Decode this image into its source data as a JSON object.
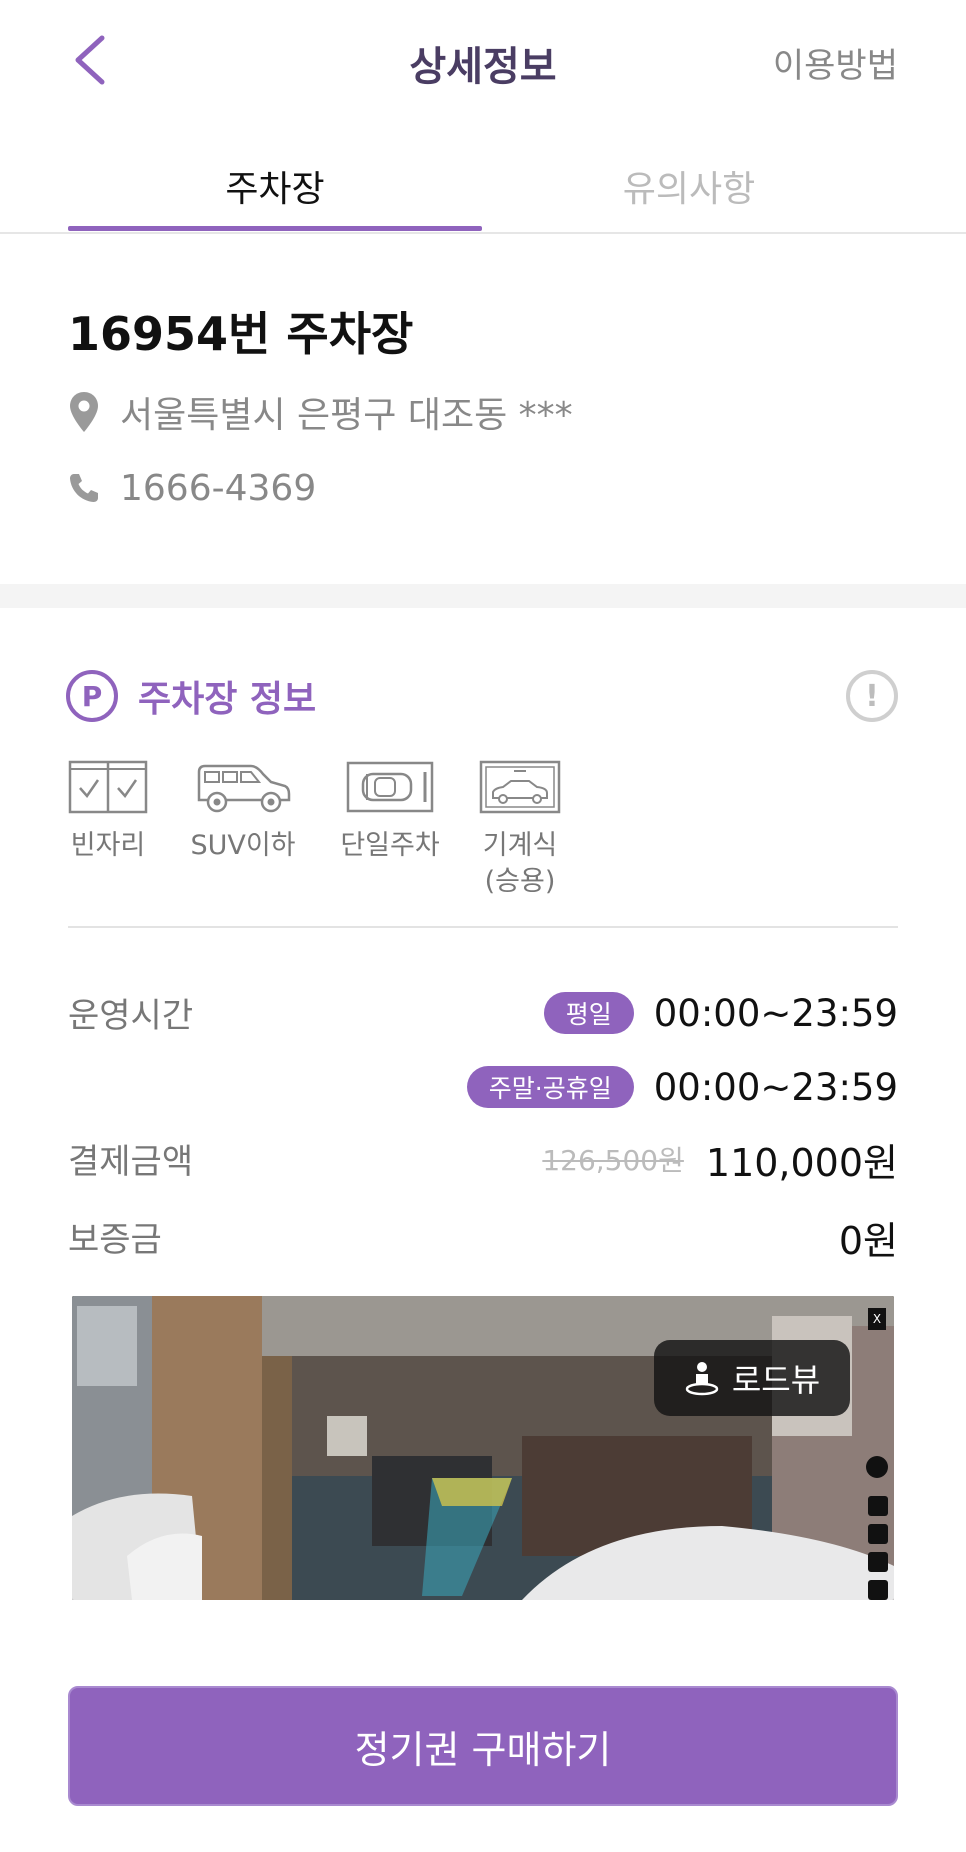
{
  "header": {
    "title": "상세정보",
    "help_link": "이용방법"
  },
  "tabs": [
    {
      "label": "주차장",
      "active": true
    },
    {
      "label": "유의사항",
      "active": false
    }
  ],
  "lot": {
    "name": "16954번 주차장",
    "address": "서울특별시 은평구 대조동 ***",
    "phone": "1666-4369"
  },
  "section": {
    "icon_letter": "P",
    "title": "주차장 정보",
    "alert_symbol": "!"
  },
  "features": [
    {
      "icon": "empty-space-icon",
      "label": "빈자리"
    },
    {
      "icon": "suv-icon",
      "label": "SUV이하"
    },
    {
      "icon": "single-parking-icon",
      "label": "단일주차"
    },
    {
      "icon": "mechanical-parking-icon",
      "label": "기계식\n(승용)"
    }
  ],
  "hours": {
    "label": "운영시간",
    "weekday_badge": "평일",
    "weekday_time": "00:00~23:59",
    "weekend_badge": "주말·공휴일",
    "weekend_time": "00:00~23:59"
  },
  "payment": {
    "label": "결제금액",
    "original": "126,500원",
    "final": "110,000원"
  },
  "deposit": {
    "label": "보증금",
    "value": "0원"
  },
  "roadview": {
    "button_label": "로드뷰",
    "close_label": "X"
  },
  "cta": {
    "label": "정기권 구매하기"
  },
  "colors": {
    "accent": "#8f63bd",
    "title": "#4a3d63",
    "muted": "#888888"
  }
}
